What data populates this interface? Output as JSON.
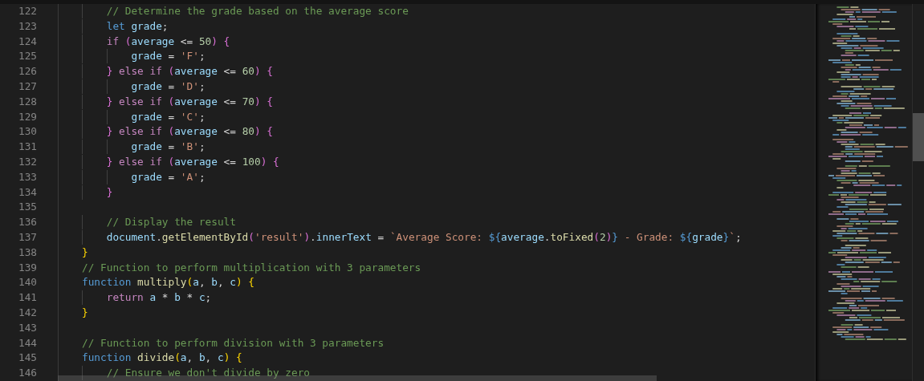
{
  "editor": {
    "lines": [
      {
        "number": "122",
        "tokens": [
          {
            "kind": "comment",
            "text": "    // Determine the grade based on the average score"
          }
        ]
      },
      {
        "number": "123",
        "tokens": [
          {
            "kind": "keyword",
            "text": "    let"
          },
          {
            "kind": "variable",
            "text": " grade"
          },
          {
            "kind": "punct",
            "text": ";"
          }
        ]
      },
      {
        "number": "124",
        "tokens": [
          {
            "kind": "control",
            "text": "    if"
          },
          {
            "kind": "bracket2",
            "text": " ("
          },
          {
            "kind": "variable",
            "text": "average"
          },
          {
            "kind": "punct",
            "text": " <= "
          },
          {
            "kind": "number",
            "text": "50"
          },
          {
            "kind": "bracket2",
            "text": ")"
          },
          {
            "kind": "bracket2",
            "text": " {"
          }
        ]
      },
      {
        "number": "125",
        "tokens": [
          {
            "kind": "variable",
            "text": "        grade"
          },
          {
            "kind": "punct",
            "text": " = "
          },
          {
            "kind": "string",
            "text": "'F'"
          },
          {
            "kind": "punct",
            "text": ";"
          }
        ]
      },
      {
        "number": "126",
        "tokens": [
          {
            "kind": "bracket2",
            "text": "    }"
          },
          {
            "kind": "control",
            "text": " else if"
          },
          {
            "kind": "bracket2",
            "text": " ("
          },
          {
            "kind": "variable",
            "text": "average"
          },
          {
            "kind": "punct",
            "text": " <= "
          },
          {
            "kind": "number",
            "text": "60"
          },
          {
            "kind": "bracket2",
            "text": ")"
          },
          {
            "kind": "bracket2",
            "text": " {"
          }
        ]
      },
      {
        "number": "127",
        "tokens": [
          {
            "kind": "variable",
            "text": "        grade"
          },
          {
            "kind": "punct",
            "text": " = "
          },
          {
            "kind": "string",
            "text": "'D'"
          },
          {
            "kind": "punct",
            "text": ";"
          }
        ]
      },
      {
        "number": "128",
        "tokens": [
          {
            "kind": "bracket2",
            "text": "    }"
          },
          {
            "kind": "control",
            "text": " else if"
          },
          {
            "kind": "bracket2",
            "text": " ("
          },
          {
            "kind": "variable",
            "text": "average"
          },
          {
            "kind": "punct",
            "text": " <= "
          },
          {
            "kind": "number",
            "text": "70"
          },
          {
            "kind": "bracket2",
            "text": ")"
          },
          {
            "kind": "bracket2",
            "text": " {"
          }
        ]
      },
      {
        "number": "129",
        "tokens": [
          {
            "kind": "variable",
            "text": "        grade"
          },
          {
            "kind": "punct",
            "text": " = "
          },
          {
            "kind": "string",
            "text": "'C'"
          },
          {
            "kind": "punct",
            "text": ";"
          }
        ]
      },
      {
        "number": "130",
        "tokens": [
          {
            "kind": "bracket2",
            "text": "    }"
          },
          {
            "kind": "control",
            "text": " else if"
          },
          {
            "kind": "bracket2",
            "text": " ("
          },
          {
            "kind": "variable",
            "text": "average"
          },
          {
            "kind": "punct",
            "text": " <= "
          },
          {
            "kind": "number",
            "text": "80"
          },
          {
            "kind": "bracket2",
            "text": ")"
          },
          {
            "kind": "bracket2",
            "text": " {"
          }
        ]
      },
      {
        "number": "131",
        "tokens": [
          {
            "kind": "variable",
            "text": "        grade"
          },
          {
            "kind": "punct",
            "text": " = "
          },
          {
            "kind": "string",
            "text": "'B'"
          },
          {
            "kind": "punct",
            "text": ";"
          }
        ]
      },
      {
        "number": "132",
        "tokens": [
          {
            "kind": "bracket2",
            "text": "    }"
          },
          {
            "kind": "control",
            "text": " else if"
          },
          {
            "kind": "bracket2",
            "text": " ("
          },
          {
            "kind": "variable",
            "text": "average"
          },
          {
            "kind": "punct",
            "text": " <= "
          },
          {
            "kind": "number",
            "text": "100"
          },
          {
            "kind": "bracket2",
            "text": ")"
          },
          {
            "kind": "bracket2",
            "text": " {"
          }
        ]
      },
      {
        "number": "133",
        "tokens": [
          {
            "kind": "variable",
            "text": "        grade"
          },
          {
            "kind": "punct",
            "text": " = "
          },
          {
            "kind": "string",
            "text": "'A'"
          },
          {
            "kind": "punct",
            "text": ";"
          }
        ]
      },
      {
        "number": "134",
        "tokens": [
          {
            "kind": "bracket2",
            "text": "    }"
          }
        ]
      },
      {
        "number": "135"
      },
      {
        "number": "136",
        "tokens": [
          {
            "kind": "comment",
            "text": "    // Display the result"
          }
        ]
      },
      {
        "number": "137",
        "tokens": [
          {
            "kind": "variable",
            "text": "    document"
          },
          {
            "kind": "punct",
            "text": "."
          },
          {
            "kind": "function",
            "text": "getElementById"
          },
          {
            "kind": "bracket2",
            "text": "("
          },
          {
            "kind": "string",
            "text": "'result'"
          },
          {
            "kind": "bracket2",
            "text": ")"
          },
          {
            "kind": "punct",
            "text": "."
          },
          {
            "kind": "variable",
            "text": "innerText"
          },
          {
            "kind": "punct",
            "text": " = "
          },
          {
            "kind": "string",
            "text": "`Average Score: "
          },
          {
            "kind": "template",
            "text": "${"
          },
          {
            "kind": "variable",
            "text": "average"
          },
          {
            "kind": "punct",
            "text": "."
          },
          {
            "kind": "function",
            "text": "toFixed"
          },
          {
            "kind": "bracket2",
            "text": "("
          },
          {
            "kind": "number",
            "text": "2"
          },
          {
            "kind": "bracket2",
            "text": ")"
          },
          {
            "kind": "template",
            "text": "}"
          },
          {
            "kind": "string",
            "text": " - Grade: "
          },
          {
            "kind": "template",
            "text": "${"
          },
          {
            "kind": "variable",
            "text": "grade"
          },
          {
            "kind": "template",
            "text": "}"
          },
          {
            "kind": "string",
            "text": "`"
          },
          {
            "kind": "punct",
            "text": ";"
          }
        ]
      },
      {
        "number": "138",
        "tokens": [
          {
            "kind": "bracket1",
            "text": "}"
          }
        ]
      },
      {
        "number": "139",
        "tokens": [
          {
            "kind": "comment",
            "text": "// Function to perform multiplication with 3 parameters"
          }
        ]
      },
      {
        "number": "140",
        "tokens": [
          {
            "kind": "keyword",
            "text": "function"
          },
          {
            "kind": "function",
            "text": " multiply"
          },
          {
            "kind": "bracket1",
            "text": "("
          },
          {
            "kind": "variable",
            "text": "a"
          },
          {
            "kind": "punct",
            "text": ","
          },
          {
            "kind": "variable",
            "text": " b"
          },
          {
            "kind": "punct",
            "text": ","
          },
          {
            "kind": "variable",
            "text": " c"
          },
          {
            "kind": "bracket1",
            "text": ")"
          },
          {
            "kind": "bracket1",
            "text": " {"
          }
        ]
      },
      {
        "number": "141",
        "tokens": [
          {
            "kind": "control",
            "text": "    return"
          },
          {
            "kind": "variable",
            "text": " a"
          },
          {
            "kind": "punct",
            "text": " * "
          },
          {
            "kind": "variable",
            "text": "b"
          },
          {
            "kind": "punct",
            "text": " * "
          },
          {
            "kind": "variable",
            "text": "c"
          },
          {
            "kind": "punct",
            "text": ";"
          }
        ]
      },
      {
        "number": "142",
        "tokens": [
          {
            "kind": "bracket1",
            "text": "}"
          }
        ]
      },
      {
        "number": "143"
      },
      {
        "number": "144",
        "tokens": [
          {
            "kind": "comment",
            "text": "// Function to perform division with 3 parameters"
          }
        ]
      },
      {
        "number": "145",
        "tokens": [
          {
            "kind": "keyword",
            "text": "function"
          },
          {
            "kind": "function",
            "text": " divide"
          },
          {
            "kind": "bracket1",
            "text": "("
          },
          {
            "kind": "variable",
            "text": "a"
          },
          {
            "kind": "punct",
            "text": ","
          },
          {
            "kind": "variable",
            "text": " b"
          },
          {
            "kind": "punct",
            "text": ","
          },
          {
            "kind": "variable",
            "text": " c"
          },
          {
            "kind": "bracket1",
            "text": ")"
          },
          {
            "kind": "bracket1",
            "text": " {"
          }
        ]
      },
      {
        "number": "146",
        "tokens": [
          {
            "kind": "comment",
            "text": "    // Ensure we don't divide by zero"
          }
        ]
      }
    ]
  }
}
